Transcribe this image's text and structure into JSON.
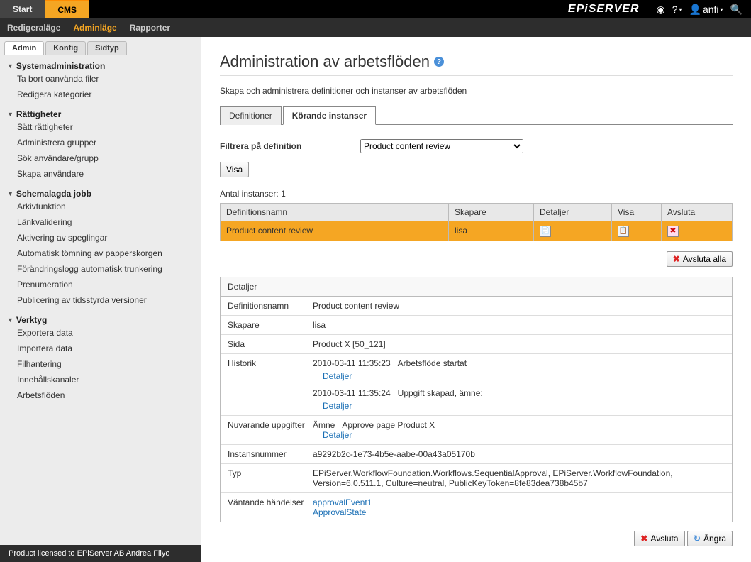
{
  "topbar": {
    "start": "Start",
    "cms": "CMS",
    "logo": "EPiSERVER",
    "user": "anfi"
  },
  "modebar": {
    "edit": "Redigeraläge",
    "admin": "Adminläge",
    "reports": "Rapporter"
  },
  "adminTabs": {
    "admin": "Admin",
    "config": "Konfig",
    "pagetype": "Sidtyp"
  },
  "nav": {
    "sysadmin": {
      "title": "Systemadministration",
      "items": [
        "Ta bort oanvända filer",
        "Redigera kategorier"
      ]
    },
    "rights": {
      "title": "Rättigheter",
      "items": [
        "Sätt rättigheter",
        "Administrera grupper",
        "Sök användare/grupp",
        "Skapa användare"
      ]
    },
    "jobs": {
      "title": "Schemalagda jobb",
      "items": [
        "Arkivfunktion",
        "Länkvalidering",
        "Aktivering av speglingar",
        "Automatisk tömning av papperskorgen",
        "Förändringslogg automatisk trunkering",
        "Prenumeration",
        "Publicering av tidsstyrda versioner"
      ]
    },
    "tools": {
      "title": "Verktyg",
      "items": [
        "Exportera data",
        "Importera data",
        "Filhantering",
        "Innehållskanaler",
        "Arbetsflöden"
      ]
    }
  },
  "sidebarFooter": "Product licensed to EPiServer AB Andrea Filyo",
  "page": {
    "title": "Administration av arbetsflöden",
    "desc": "Skapa och administrera definitioner och instanser av arbetsflöden"
  },
  "contentTabs": {
    "def": "Definitioner",
    "running": "Körande instanser"
  },
  "filter": {
    "label": "Filtrera på definition",
    "selected": "Product content review",
    "showBtn": "Visa"
  },
  "countLabel": "Antal instanser:",
  "count": "1",
  "table": {
    "headers": {
      "name": "Definitionsnamn",
      "creator": "Skapare",
      "details": "Detaljer",
      "show": "Visa",
      "end": "Avsluta"
    },
    "rows": [
      {
        "name": "Product content review",
        "creator": "lisa"
      }
    ]
  },
  "endAllBtn": "Avsluta alla",
  "details": {
    "head": "Detaljer",
    "labels": {
      "name": "Definitionsnamn",
      "creator": "Skapare",
      "page": "Sida",
      "history": "Historik",
      "current": "Nuvarande uppgifter",
      "instance": "Instansnummer",
      "type": "Typ",
      "waiting": "Väntande händelser"
    },
    "values": {
      "name": "Product content review",
      "creator": "lisa",
      "page": "Product X [50_121]",
      "hist1_time": "2010-03-11 11:35:23",
      "hist1_text": "Arbetsflöde startat",
      "hist2_time": "2010-03-11 11:35:24",
      "hist2_text": "Uppgift skapad, ämne:",
      "detailsLink": "Detaljer",
      "cur_subject": "Ämne",
      "cur_text": "Approve page Product X",
      "instance": "a9292b2c-1e73-4b5e-aabe-00a43a05170b",
      "type": "EPiServer.WorkflowFoundation.Workflows.SequentialApproval, EPiServer.WorkflowFoundation, Version=6.0.511.1, Culture=neutral, PublicKeyToken=8fe83dea738b45b7",
      "wait1": "approvalEvent1",
      "wait2": "ApprovalState"
    }
  },
  "footer": {
    "end": "Avsluta",
    "undo": "Ångra"
  }
}
